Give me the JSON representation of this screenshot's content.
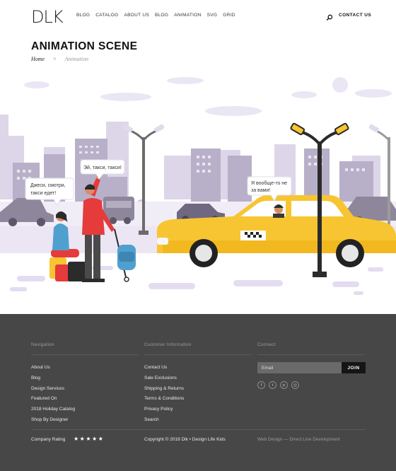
{
  "header": {
    "logo": "DLK",
    "nav": [
      "BLOG",
      "CATALOG",
      "ABOUT US",
      "BLOG",
      "ANIMATION",
      "SVG",
      "GRID"
    ],
    "search_icon": "search-icon",
    "contact": "CONTACT US"
  },
  "page": {
    "title": "ANIMATION SCENE",
    "breadcrumb": {
      "home": "Home",
      "separator": ">",
      "current": "Animation"
    }
  },
  "scene": {
    "bubble_woman": [
      "Джеси, смотри,",
      "такси едет!"
    ],
    "bubble_man": "Эй, такси, такси!",
    "bubble_driver": [
      "Я вообще-то не",
      "за вами!"
    ],
    "colors": {
      "taxi": "#f7c531",
      "buildings": "#b7afc6",
      "sky_accent": "#e6e0f0",
      "man_shirt": "#e63b3b"
    }
  },
  "footer": {
    "navigation": {
      "heading": "Navigation",
      "items": [
        "About Us",
        "Blog",
        "Design Services",
        "Featured On",
        "2018 Holiday Catalog",
        "Shop By Designer"
      ]
    },
    "customer": {
      "heading": "Customer Information",
      "items": [
        "Contact Us",
        "Sale Exclusions",
        "Shipping & Returns",
        "Terms & Conditions",
        "Privacy Policy",
        "Search"
      ]
    },
    "connect": {
      "heading": "Connect",
      "email_placeholder": "Email",
      "join": "JOIN",
      "socials": [
        {
          "icon": "facebook-icon",
          "glyph": "f"
        },
        {
          "icon": "twitter-icon",
          "glyph": "t"
        },
        {
          "icon": "pinterest-icon",
          "glyph": "p"
        },
        {
          "icon": "instagram-icon",
          "glyph": "◎"
        }
      ]
    },
    "rating_label": "Company Rating",
    "stars": "★★★★★",
    "rating_value": 5,
    "copyright": "Copyright © 2018 Dlk • Design Life Kids",
    "credit": "Web Design — Direct Line Development"
  }
}
